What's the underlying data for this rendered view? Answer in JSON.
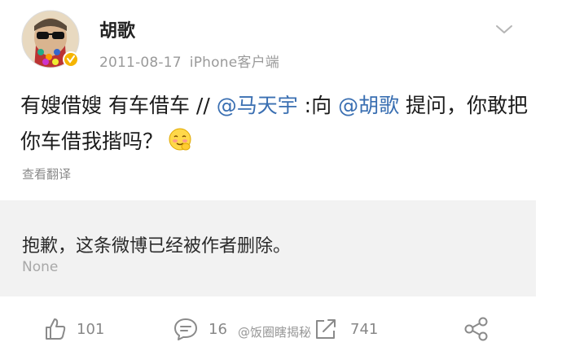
{
  "post": {
    "author": "胡歌",
    "date": "2011-08-17",
    "source": "iPhone客户端",
    "text_part1": "有嫂借嫂 有车借车 //",
    "mention1": "@马天宇",
    "text_part2": ":向",
    "mention2": "@胡歌",
    "text_part3": "提问，你敢把你车借我揩吗？",
    "translate_label": "查看翻译"
  },
  "repost": {
    "deleted_message": "抱歉，这条微博已经被作者删除。",
    "footer_text": "None"
  },
  "actions": {
    "like_count": "101",
    "comment_count": "16",
    "repost_count": "741"
  },
  "watermark": "@饭圈瞎揭秘",
  "colors": {
    "mention": "#3a6fb2",
    "verified_badge": "#f5b400",
    "repost_bg": "#f2f2f2"
  },
  "icons": [
    "avatar-image",
    "verified-badge-icon",
    "chevron-down-icon",
    "blush-emoji-icon",
    "like-thumb-icon",
    "comment-bubble-icon",
    "repost-arrow-icon",
    "share-icon"
  ]
}
